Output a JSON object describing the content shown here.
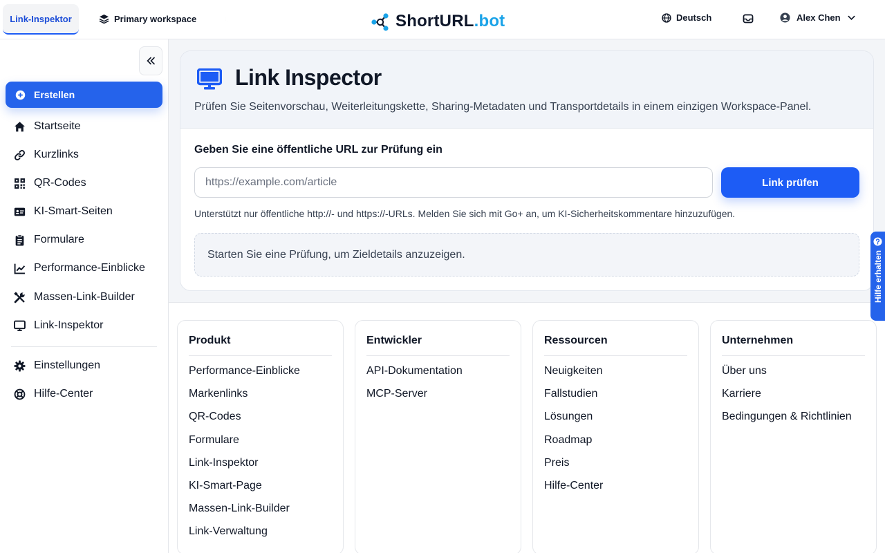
{
  "header": {
    "active_tab": "Link-Inspektor",
    "workspace": "Primary workspace",
    "brand_main": "ShortURL",
    "brand_accent": ".bot",
    "language": "Deutsch",
    "user_name": "Alex Chen"
  },
  "sidebar": {
    "create_label": "Erstellen",
    "items": [
      {
        "label": "Startseite",
        "icon": "home-icon"
      },
      {
        "label": "Kurzlinks",
        "icon": "link-icon"
      },
      {
        "label": "QR-Codes",
        "icon": "qr-code-icon"
      },
      {
        "label": "KI-Smart-Seiten",
        "icon": "id-card-icon"
      },
      {
        "label": "Formulare",
        "icon": "clipboard-icon"
      },
      {
        "label": "Performance-Einblicke",
        "icon": "chart-line-icon"
      },
      {
        "label": "Massen-Link-Builder",
        "icon": "tools-icon"
      },
      {
        "label": "Link-Inspektor",
        "icon": "monitor-icon"
      }
    ],
    "bottom_items": [
      {
        "label": "Einstellungen",
        "icon": "gear-icon"
      },
      {
        "label": "Hilfe-Center",
        "icon": "lifebuoy-icon"
      }
    ]
  },
  "inspector": {
    "title": "Link Inspector",
    "subtitle": "Prüfen Sie Seitenvorschau, Weiterleitungskette, Sharing-Metadaten und Transportdetails in einem einzigen Workspace-Panel.",
    "field_label": "Geben Sie eine öffentliche URL zur Prüfung ein",
    "url_placeholder": "https://example.com/article",
    "url_value": "",
    "check_button": "Link prüfen",
    "hint": "Unterstützt nur öffentliche http://- und https://-URLs. Melden Sie sich mit Go+ an, um KI-Sicherheitskommentare hinzuzufügen.",
    "empty_state": "Starten Sie eine Prüfung, um Zieldetails anzuzeigen."
  },
  "footer": {
    "columns": [
      {
        "title": "Produkt",
        "links": [
          "Performance-Einblicke",
          "Markenlinks",
          "QR-Codes",
          "Formulare",
          "Link-Inspektor",
          "KI-Smart-Page",
          "Massen-Link-Builder",
          "Link-Verwaltung"
        ]
      },
      {
        "title": "Entwickler",
        "links": [
          "API-Dokumentation",
          "MCP-Server"
        ]
      },
      {
        "title": "Ressourcen",
        "links": [
          "Neuigkeiten",
          "Fallstudien",
          "Lösungen",
          "Roadmap",
          "Preis",
          "Hilfe-Center"
        ]
      },
      {
        "title": "Unternehmen",
        "links": [
          "Über uns",
          "Karriere",
          "Bedingungen & Richtlinien"
        ]
      }
    ]
  },
  "help_tab": "Hilfe erhalten",
  "colors": {
    "accent": "#1d5cf5",
    "brand_accent": "#1aa3e8",
    "text": "#111827"
  }
}
